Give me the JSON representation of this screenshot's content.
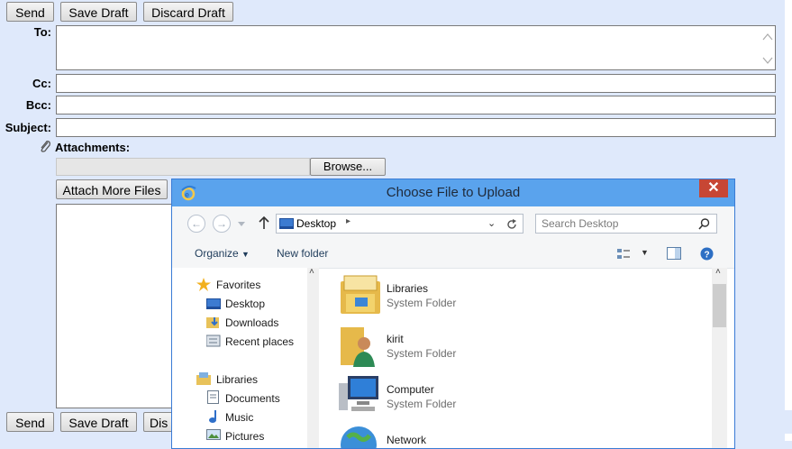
{
  "compose": {
    "top_buttons": {
      "send": "Send",
      "save_draft": "Save Draft",
      "discard_draft": "Discard Draft"
    },
    "labels": {
      "to": "To:",
      "cc": "Cc:",
      "bcc": "Bcc:",
      "subject": "Subject:",
      "attachments": "Attachments:"
    },
    "values": {
      "to": "",
      "cc": "",
      "bcc": "",
      "subject": "",
      "file": ""
    },
    "browse": "Browse...",
    "attach_more": "Attach More Files",
    "bottom_buttons": {
      "send": "Send",
      "save_draft": "Save Draft",
      "discard_partial": "Dis"
    }
  },
  "dialog": {
    "title": "Choose File to Upload",
    "close": "✕",
    "address": "Desktop",
    "search_placeholder": "Search Desktop",
    "toolbar": {
      "organize": "Organize",
      "new_folder": "New folder"
    },
    "nav_pane": {
      "favorites_label": "Favorites",
      "favorites": [
        "Desktop",
        "Downloads",
        "Recent places"
      ],
      "libraries_label": "Libraries",
      "libraries": [
        "Documents",
        "Music",
        "Pictures"
      ]
    },
    "items": [
      {
        "name": "Libraries",
        "type": "System Folder"
      },
      {
        "name": "kirit",
        "type": "System Folder"
      },
      {
        "name": "Computer",
        "type": "System Folder"
      },
      {
        "name": "Network",
        "type": ""
      }
    ]
  },
  "colors": {
    "page_bg": "#dfe9fb",
    "title_bar": "#5aa3ed",
    "close": "#c74634"
  }
}
